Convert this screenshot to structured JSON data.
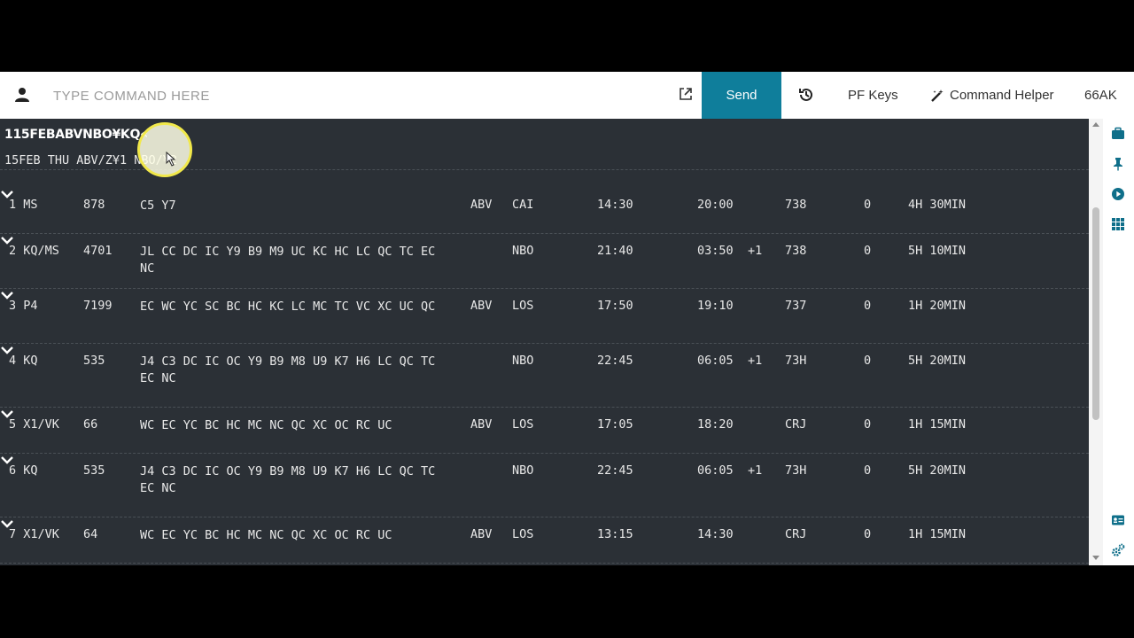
{
  "topbar": {
    "user_icon": "user-icon",
    "command_placeholder": "TYPE COMMAND HERE",
    "popout_icon": "external-link-icon",
    "send_label": "Send",
    "history_icon": "history-icon",
    "pf_keys_label": "PF Keys",
    "command_helper_label": "Command Helper",
    "command_helper_icon": "magic-wand-icon",
    "user_code": "66AK"
  },
  "terminal": {
    "echo": "115FEBABVNBO¥KQ«",
    "header": "15FEB THU ABV/Z¥1 NBO/¥2",
    "rows": [
      {
        "num": "1 MS",
        "flight": "878",
        "classes": "C5 Y7",
        "origin": "ABV",
        "dest": "CAI",
        "dep": "14:30",
        "arr": "20:00",
        "day": "",
        "equip": "738",
        "stops": "0",
        "duration": "4H 30MIN"
      },
      {
        "num": "2 KQ/MS",
        "flight": "4701",
        "classes": "JL CC DC IC Y9 B9 M9 UC KC HC LC QC TC EC NC",
        "origin": "",
        "dest": "NBO",
        "dep": "21:40",
        "arr": "03:50",
        "day": "+1",
        "equip": "738",
        "stops": "0",
        "duration": "5H 10MIN"
      },
      {
        "num": "3 P4",
        "flight": "7199",
        "classes": "EC WC YC SC BC HC KC LC MC TC VC XC UC QC",
        "origin": "ABV",
        "dest": "LOS",
        "dep": "17:50",
        "arr": "19:10",
        "day": "",
        "equip": "737",
        "stops": "0",
        "duration": "1H 20MIN"
      },
      {
        "num": "4 KQ",
        "flight": "535",
        "classes": "J4 C3 DC IC OC Y9 B9 M8 U9 K7 H6 LC QC TC EC NC",
        "origin": "",
        "dest": "NBO",
        "dep": "22:45",
        "arr": "06:05",
        "day": "+1",
        "equip": "73H",
        "stops": "0",
        "duration": "5H 20MIN"
      },
      {
        "num": "5 X1/VK",
        "flight": "66",
        "classes": "WC EC YC BC HC MC NC QC XC OC RC UC",
        "origin": "ABV",
        "dest": "LOS",
        "dep": "17:05",
        "arr": "18:20",
        "day": "",
        "equip": "CRJ",
        "stops": "0",
        "duration": "1H 15MIN"
      },
      {
        "num": "6 KQ",
        "flight": "535",
        "classes": "J4 C3 DC IC OC Y9 B9 M8 U9 K7 H6 LC QC TC EC NC",
        "origin": "",
        "dest": "NBO",
        "dep": "22:45",
        "arr": "06:05",
        "day": "+1",
        "equip": "73H",
        "stops": "0",
        "duration": "5H 20MIN"
      },
      {
        "num": "7 X1/VK",
        "flight": "64",
        "classes": "WC EC YC BC HC MC NC QC XC OC RC UC",
        "origin": "ABV",
        "dest": "LOS",
        "dep": "13:15",
        "arr": "14:30",
        "day": "",
        "equip": "CRJ",
        "stops": "0",
        "duration": "1H 15MIN"
      }
    ]
  },
  "rail_icons": [
    "briefcase-icon",
    "pin-icon",
    "play-circle-icon",
    "grid-icon",
    "id-card-icon",
    "settings-cogs-icon"
  ],
  "colors": {
    "send": "#0f7e9b",
    "terminal_bg": "#2b3036",
    "cursor_ring": "#f1e84a"
  }
}
